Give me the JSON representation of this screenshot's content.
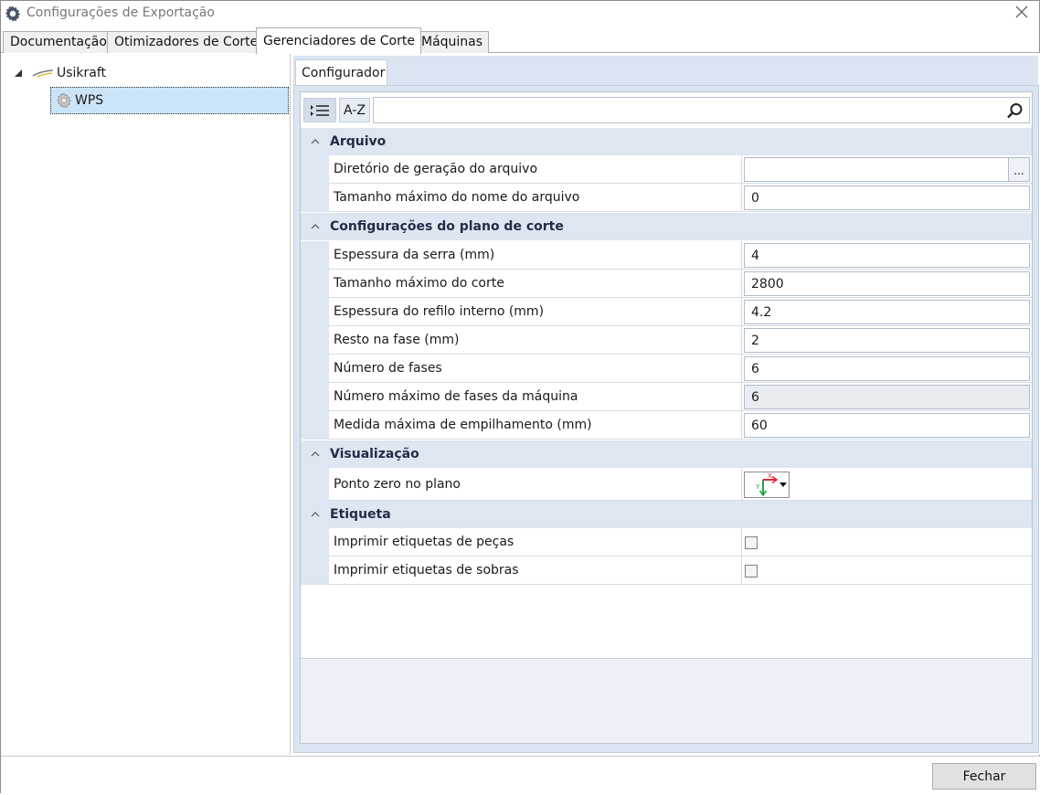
{
  "window": {
    "title": "Configurações de Exportação",
    "close_icon": "close-icon",
    "app_icon": "gear-icon"
  },
  "tabs": [
    {
      "label": "Documentação"
    },
    {
      "label": "Otimizadores de Corte"
    },
    {
      "label": "Gerenciadores de Corte",
      "active": true
    },
    {
      "label": "Máquinas"
    }
  ],
  "tree": {
    "root": {
      "label": "Usikraft",
      "icon": "usikraft-logo-icon",
      "expanded": true
    },
    "child": {
      "label": "WPS",
      "icon": "gear-icon",
      "selected": true
    }
  },
  "subtab": {
    "label": "Configurador"
  },
  "toolbar": {
    "categorized_icon": "categorized-view-icon",
    "az_label": "A-Z",
    "search_value": "",
    "search_icon": "search-icon"
  },
  "groups": {
    "arquivo": {
      "title": "Arquivo",
      "props": {
        "diretorio": {
          "name": "Diretório de geração do arquivo",
          "value": "",
          "button": "..."
        },
        "tamanho_nome": {
          "name": "Tamanho máximo do nome do arquivo",
          "value": "0"
        }
      }
    },
    "plano": {
      "title": "Configurações do plano de corte",
      "props": {
        "espessura_serra": {
          "name": "Espessura da serra (mm)",
          "value": "4"
        },
        "tamanho_corte": {
          "name": "Tamanho máximo do corte",
          "value": "2800"
        },
        "espessura_refilo": {
          "name": "Espessura do refilo interno (mm)",
          "value": "4.2"
        },
        "resto_fase": {
          "name": "Resto na fase (mm)",
          "value": "2"
        },
        "numero_fases": {
          "name": "Número de fases",
          "value": "6"
        },
        "max_fases": {
          "name": "Número máximo de fases da máquina",
          "value": "6",
          "readonly": true
        },
        "empilhamento": {
          "name": "Medida máxima de empilhamento (mm)",
          "value": "60"
        }
      }
    },
    "visualizacao": {
      "title": "Visualização",
      "props": {
        "ponto_zero": {
          "name": "Ponto zero no plano",
          "axis_x_label": "X",
          "axis_y_label": "Y",
          "icon": "axis-origin-icon"
        }
      }
    },
    "etiqueta": {
      "title": "Etiqueta",
      "props": {
        "pecas": {
          "name": "Imprimir etiquetas de peças",
          "checked": false
        },
        "sobras": {
          "name": "Imprimir etiquetas de sobras",
          "checked": false
        }
      }
    }
  },
  "footer": {
    "close_button": "Fechar"
  },
  "colors": {
    "group_header_bg": "#dde6f1",
    "selection_bg": "#cce4f7",
    "axis_x": "#e0283a",
    "axis_y": "#22a34a"
  }
}
